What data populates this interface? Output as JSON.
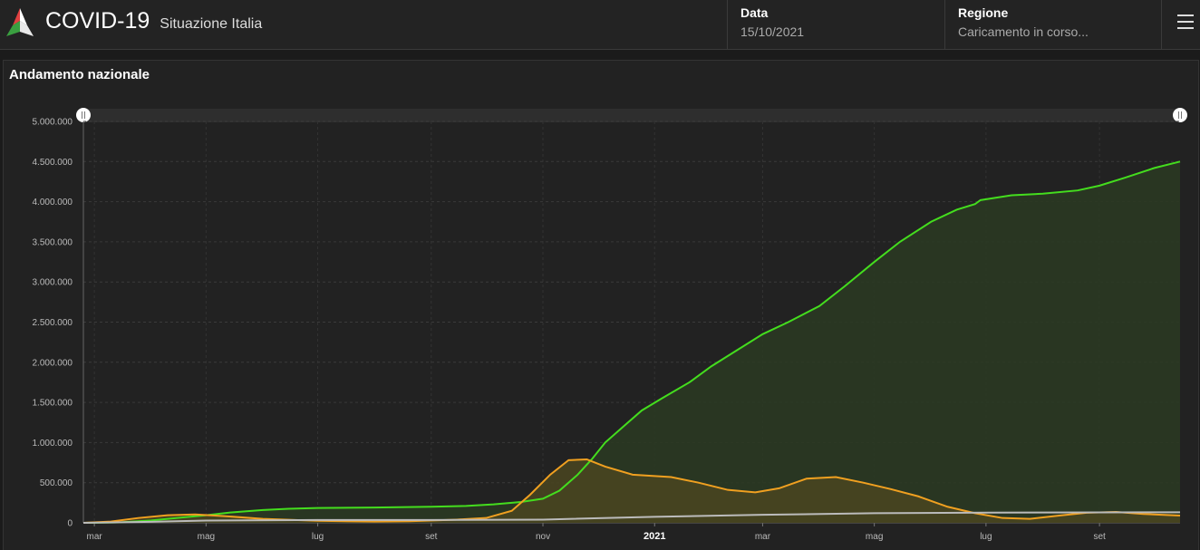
{
  "header": {
    "title": "COVID-19",
    "subtitle": "Situazione Italia",
    "date_label": "Data",
    "date_value": "15/10/2021",
    "region_label": "Regione",
    "region_value": "Caricamento in corso..."
  },
  "panel": {
    "title": "Andamento nazionale"
  },
  "colors": {
    "green": "#44dd1e",
    "orange": "#f0a020",
    "gray": "#bbbbbb",
    "green_fill": "#2a3a22",
    "orange_fill": "#4a4520"
  },
  "chart_data": {
    "type": "area",
    "ylim": [
      0,
      5000000
    ],
    "yticks": [
      {
        "v": 0,
        "label": "0"
      },
      {
        "v": 500000,
        "label": "500.000"
      },
      {
        "v": 1000000,
        "label": "1.000.000"
      },
      {
        "v": 1500000,
        "label": "1.500.000"
      },
      {
        "v": 2000000,
        "label": "2.000.000"
      },
      {
        "v": 2500000,
        "label": "2.500.000"
      },
      {
        "v": 3000000,
        "label": "3.000.000"
      },
      {
        "v": 3500000,
        "label": "3.500.000"
      },
      {
        "v": 4000000,
        "label": "4.000.000"
      },
      {
        "v": 4500000,
        "label": "4.500.000"
      },
      {
        "v": 5000000,
        "label": "5.000.000"
      }
    ],
    "xlim": [
      "2020-02-24",
      "2021-10-15"
    ],
    "xticks": [
      {
        "date": "2020-03-01",
        "label": "mar"
      },
      {
        "date": "2020-05-01",
        "label": "mag"
      },
      {
        "date": "2020-07-01",
        "label": "lug"
      },
      {
        "date": "2020-09-01",
        "label": "set"
      },
      {
        "date": "2020-11-01",
        "label": "nov"
      },
      {
        "date": "2021-01-01",
        "label": "2021",
        "bold": true
      },
      {
        "date": "2021-03-01",
        "label": "mar"
      },
      {
        "date": "2021-05-01",
        "label": "mag"
      },
      {
        "date": "2021-07-01",
        "label": "lug"
      },
      {
        "date": "2021-09-01",
        "label": "set"
      }
    ],
    "series": [
      {
        "color": "green",
        "fill": "green_fill",
        "points": [
          [
            "2020-02-24",
            0
          ],
          [
            "2020-03-15",
            5000
          ],
          [
            "2020-04-01",
            30000
          ],
          [
            "2020-04-15",
            60000
          ],
          [
            "2020-05-01",
            95000
          ],
          [
            "2020-05-15",
            130000
          ],
          [
            "2020-06-01",
            160000
          ],
          [
            "2020-06-15",
            175000
          ],
          [
            "2020-07-01",
            185000
          ],
          [
            "2020-08-01",
            190000
          ],
          [
            "2020-09-01",
            200000
          ],
          [
            "2020-09-20",
            210000
          ],
          [
            "2020-10-05",
            230000
          ],
          [
            "2020-10-20",
            260000
          ],
          [
            "2020-11-01",
            300000
          ],
          [
            "2020-11-10",
            400000
          ],
          [
            "2020-11-20",
            600000
          ],
          [
            "2020-11-28",
            800000
          ],
          [
            "2020-12-05",
            1000000
          ],
          [
            "2020-12-15",
            1200000
          ],
          [
            "2020-12-25",
            1400000
          ],
          [
            "2021-01-05",
            1550000
          ],
          [
            "2021-01-20",
            1750000
          ],
          [
            "2021-02-01",
            1950000
          ],
          [
            "2021-02-15",
            2150000
          ],
          [
            "2021-03-01",
            2350000
          ],
          [
            "2021-03-15",
            2500000
          ],
          [
            "2021-04-01",
            2700000
          ],
          [
            "2021-04-15",
            2950000
          ],
          [
            "2021-05-01",
            3250000
          ],
          [
            "2021-05-15",
            3500000
          ],
          [
            "2021-06-01",
            3750000
          ],
          [
            "2021-06-15",
            3900000
          ],
          [
            "2021-06-25",
            3970000
          ],
          [
            "2021-06-28",
            4020000
          ],
          [
            "2021-07-15",
            4080000
          ],
          [
            "2021-08-01",
            4100000
          ],
          [
            "2021-08-20",
            4140000
          ],
          [
            "2021-09-01",
            4200000
          ],
          [
            "2021-09-15",
            4300000
          ],
          [
            "2021-10-01",
            4420000
          ],
          [
            "2021-10-15",
            4500000
          ]
        ]
      },
      {
        "color": "orange",
        "fill": "orange_fill",
        "points": [
          [
            "2020-02-24",
            0
          ],
          [
            "2020-03-10",
            15000
          ],
          [
            "2020-03-25",
            60000
          ],
          [
            "2020-04-10",
            95000
          ],
          [
            "2020-04-25",
            105000
          ],
          [
            "2020-05-10",
            85000
          ],
          [
            "2020-06-01",
            50000
          ],
          [
            "2020-07-01",
            25000
          ],
          [
            "2020-08-01",
            15000
          ],
          [
            "2020-08-20",
            20000
          ],
          [
            "2020-09-15",
            40000
          ],
          [
            "2020-10-01",
            60000
          ],
          [
            "2020-10-15",
            150000
          ],
          [
            "2020-10-25",
            350000
          ],
          [
            "2020-11-05",
            600000
          ],
          [
            "2020-11-15",
            780000
          ],
          [
            "2020-11-25",
            790000
          ],
          [
            "2020-12-05",
            700000
          ],
          [
            "2020-12-20",
            600000
          ],
          [
            "2021-01-10",
            570000
          ],
          [
            "2021-01-25",
            500000
          ],
          [
            "2021-02-10",
            410000
          ],
          [
            "2021-02-25",
            380000
          ],
          [
            "2021-03-10",
            430000
          ],
          [
            "2021-03-25",
            550000
          ],
          [
            "2021-04-10",
            570000
          ],
          [
            "2021-04-25",
            500000
          ],
          [
            "2021-05-10",
            420000
          ],
          [
            "2021-05-25",
            330000
          ],
          [
            "2021-06-10",
            200000
          ],
          [
            "2021-06-25",
            120000
          ],
          [
            "2021-07-10",
            60000
          ],
          [
            "2021-07-25",
            50000
          ],
          [
            "2021-08-10",
            90000
          ],
          [
            "2021-08-25",
            125000
          ],
          [
            "2021-09-10",
            135000
          ],
          [
            "2021-09-25",
            110000
          ],
          [
            "2021-10-15",
            90000
          ]
        ]
      },
      {
        "color": "gray",
        "fill": null,
        "points": [
          [
            "2020-02-24",
            0
          ],
          [
            "2020-04-01",
            13000
          ],
          [
            "2020-05-01",
            28000
          ],
          [
            "2020-07-01",
            35000
          ],
          [
            "2020-09-01",
            35500
          ],
          [
            "2020-11-01",
            40000
          ],
          [
            "2021-01-01",
            75000
          ],
          [
            "2021-03-01",
            100000
          ],
          [
            "2021-05-01",
            120000
          ],
          [
            "2021-07-01",
            127000
          ],
          [
            "2021-09-01",
            130000
          ],
          [
            "2021-10-15",
            131000
          ]
        ]
      }
    ]
  }
}
